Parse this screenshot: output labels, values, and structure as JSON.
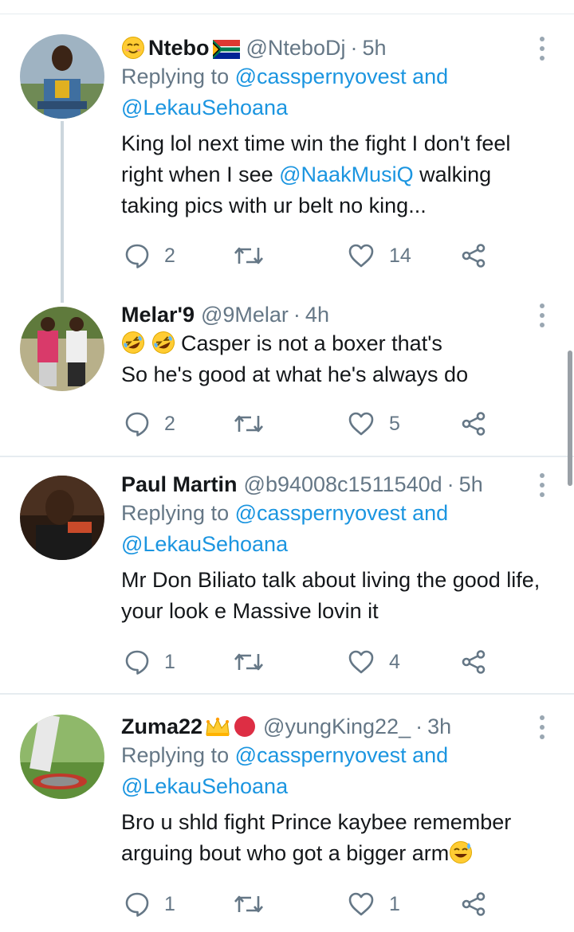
{
  "tweets": [
    {
      "name": "Ntebo",
      "handle": "@NteboDj",
      "separator": "·",
      "time": "5h",
      "replying_prefix": "Replying to",
      "replying_mention_1": "@casspernyovest",
      "replying_and": "and",
      "replying_mention_2": "@LekauSehoana",
      "text_a": "King lol next time win the fight I don't feel right when I see",
      "text_mention": "@NaakMusiQ",
      "text_b": "walking taking pics with ur belt no king...",
      "replies": "2",
      "likes": "14"
    },
    {
      "name": "Melar'9",
      "handle": "@9Melar",
      "separator": "·",
      "time": "4h",
      "text_line_1": "Casper is not a boxer that's",
      "text_line_2": "So he's good at what he's always do",
      "replies": "2",
      "likes": "5"
    },
    {
      "name": "Paul Martin",
      "handle": "@b94008c1511540d",
      "separator": "·",
      "time": "5h",
      "replying_prefix": "Replying to",
      "replying_mention_1": "@casspernyovest",
      "replying_and": "and",
      "replying_mention_2": "@LekauSehoana",
      "text": "Mr Don Biliato talk about living the good life, your look e Massive lovin it",
      "replies": "1",
      "likes": "4"
    },
    {
      "name": "Zuma22",
      "handle": "@yungKing22_",
      "separator": "·",
      "time": "3h",
      "replying_prefix": "Replying to",
      "replying_mention_1": "@casspernyovest",
      "replying_and": "and",
      "replying_mention_2": "@LekauSehoana",
      "text": "Bro u shld fight Prince kaybee remember arguing bout who got a bigger arm",
      "replies": "1",
      "likes": "1"
    }
  ],
  "icons": {
    "reply": "reply-icon",
    "retweet": "retweet-icon",
    "like": "heart-icon",
    "share": "share-icon",
    "more": "more-vertical-icon"
  },
  "colors": {
    "mention": "#1b95e0",
    "secondary_text": "#657786",
    "divider": "#e6ecf0",
    "thread_line": "#ccd6dd"
  }
}
